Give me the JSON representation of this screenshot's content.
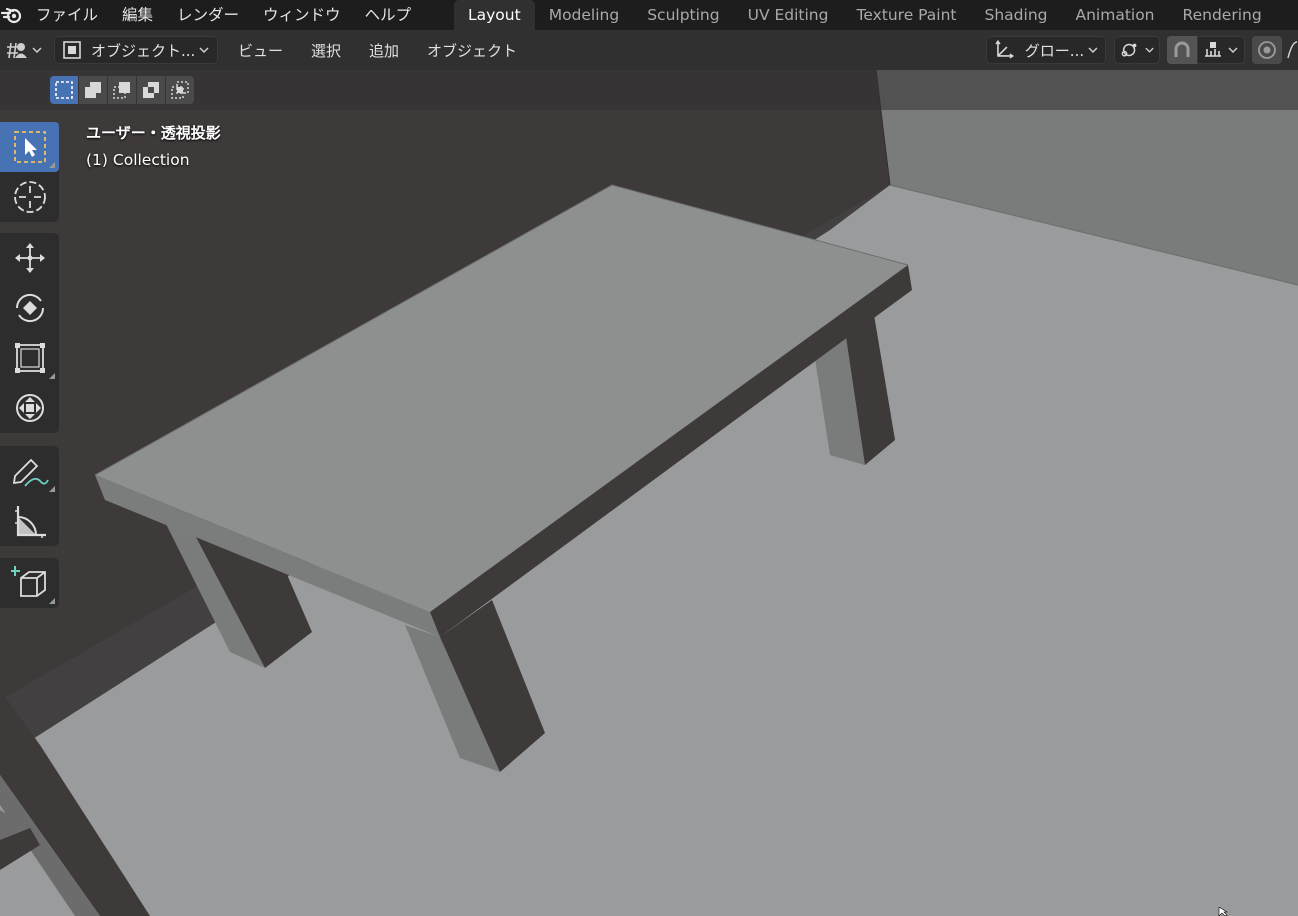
{
  "topbar": {
    "menus": [
      "ファイル",
      "編集",
      "レンダー",
      "ウィンドウ",
      "ヘルプ"
    ],
    "workspaces": [
      "Layout",
      "Modeling",
      "Sculpting",
      "UV Editing",
      "Texture Paint",
      "Shading",
      "Animation",
      "Rendering"
    ],
    "active_workspace": "Layout"
  },
  "header": {
    "mode_label": "オブジェクト...",
    "menus": [
      "ビュー",
      "選択",
      "追加",
      "オブジェクト"
    ],
    "orientation_label": "グロー..."
  },
  "viewport": {
    "view_name": "ユーザー・透視投影",
    "collection": "(1) Collection"
  },
  "toolbar": {
    "tools": [
      "select-box",
      "cursor",
      "move",
      "rotate",
      "scale",
      "transform",
      "annotate",
      "measure",
      "add-cube"
    ],
    "active_tool": "select-box"
  },
  "colors": {
    "accent": "#4772b3",
    "floor": "#9a9b9c",
    "wall_dark": "#3f3a3a",
    "wall_light": "#7a7c7b",
    "table_top": "#8e9090",
    "table_side_dark": "#3e3a3a"
  }
}
